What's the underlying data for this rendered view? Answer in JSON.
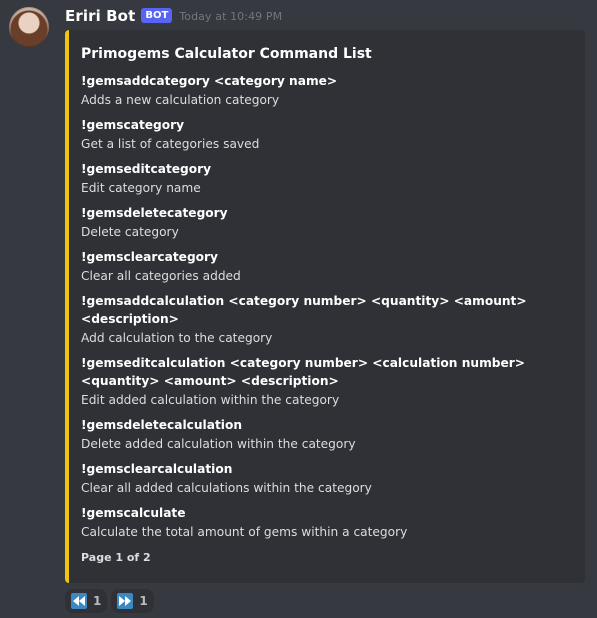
{
  "message": {
    "username": "Eriri Bot",
    "bot_tag": "BOT",
    "timestamp": "Today at 10:49 PM"
  },
  "embed": {
    "accent_color": "#f0c40f",
    "title": "Primogems Calculator Command List",
    "fields": [
      {
        "name": "!gemsaddcategory <category name>",
        "value": "Adds a new calculation category"
      },
      {
        "name": "!gemscategory",
        "value": "Get a list of categories saved"
      },
      {
        "name": "!gemseditcategory",
        "value": "Edit category name"
      },
      {
        "name": "!gemsdeletecategory",
        "value": "Delete category"
      },
      {
        "name": "!gemsclearcategory",
        "value": "Clear all categories added"
      },
      {
        "name": "!gemsaddcalculation <category number> <quantity> <amount> <description>",
        "value": "Add calculation to the category"
      },
      {
        "name": "!gemseditcalculation <category number> <calculation number> <quantity> <amount> <description>",
        "value": "Edit added calculation within the category"
      },
      {
        "name": "!gemsdeletecalculation",
        "value": "Delete added calculation within the category"
      },
      {
        "name": "!gemsclearcalculation",
        "value": "Clear all added calculations within the category"
      },
      {
        "name": "!gemscalculate",
        "value": "Calculate the total amount of gems within a category"
      }
    ],
    "footer": "Page 1 of 2"
  },
  "reactions": [
    {
      "icon": "rewind-icon",
      "count": "1"
    },
    {
      "icon": "fast-forward-icon",
      "count": "1"
    }
  ]
}
